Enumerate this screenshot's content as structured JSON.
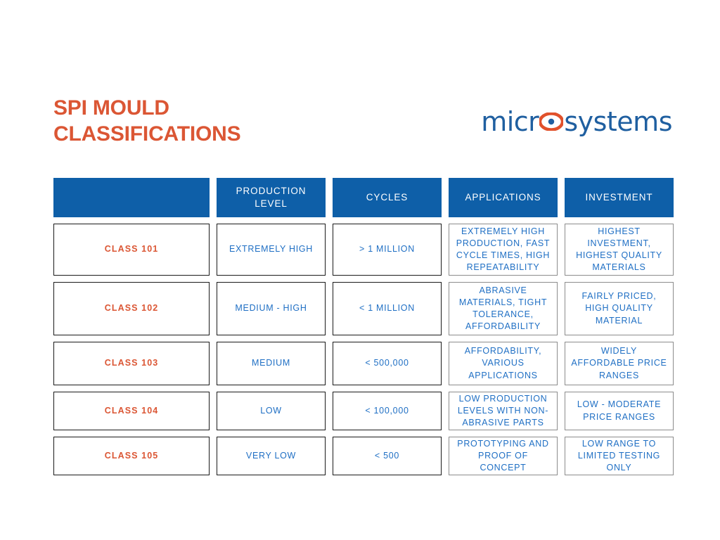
{
  "title": "SPI MOULD\nCLASSIFICATIONS",
  "logo": {
    "prefix": "micr",
    "eye_icon": "eye-logo-icon",
    "suffix": "systems"
  },
  "colors": {
    "orange": "#DB5634",
    "header_blue": "#0E5FA8",
    "body_blue": "#1F6FC4",
    "logo_blue": "#1F5FA0",
    "dark_border": "#1a1a1a",
    "grey_border": "#8c8c8c"
  },
  "table": {
    "headers": [
      "",
      "PRODUCTION LEVEL",
      "CYCLES",
      "APPLICATIONS",
      "INVESTMENT"
    ],
    "rows": [
      {
        "class": "CLASS 101",
        "production_level": "EXTREMELY HIGH",
        "cycles": "> 1 MILLION",
        "applications": "EXTREMELY HIGH PRODUCTION, FAST CYCLE TIMES, HIGH REPEATABILITY",
        "investment": "HIGHEST INVESTMENT, HIGHEST QUALITY MATERIALS"
      },
      {
        "class": "CLASS 102",
        "production_level": "MEDIUM - HIGH",
        "cycles": "< 1 MILLION",
        "applications": "ABRASIVE MATERIALS, TIGHT TOLERANCE, AFFORDABILITY",
        "investment": "FAIRLY PRICED, HIGH QUALITY MATERIAL"
      },
      {
        "class": "CLASS 103",
        "production_level": "MEDIUM",
        "cycles": "< 500,000",
        "applications": "AFFORDABILITY, VARIOUS APPLICATIONS",
        "investment": "WIDELY AFFORDABLE PRICE RANGES"
      },
      {
        "class": "CLASS 104",
        "production_level": "LOW",
        "cycles": "< 100,000",
        "applications": "LOW PRODUCTION LEVELS WITH NON-ABRASIVE PARTS",
        "investment": "LOW - MODERATE PRICE RANGES"
      },
      {
        "class": "CLASS 105",
        "production_level": "VERY LOW",
        "cycles": "< 500",
        "applications": "PROTOTYPING AND PROOF OF CONCEPT",
        "investment": "LOW RANGE TO LIMITED TESTING ONLY"
      }
    ]
  }
}
